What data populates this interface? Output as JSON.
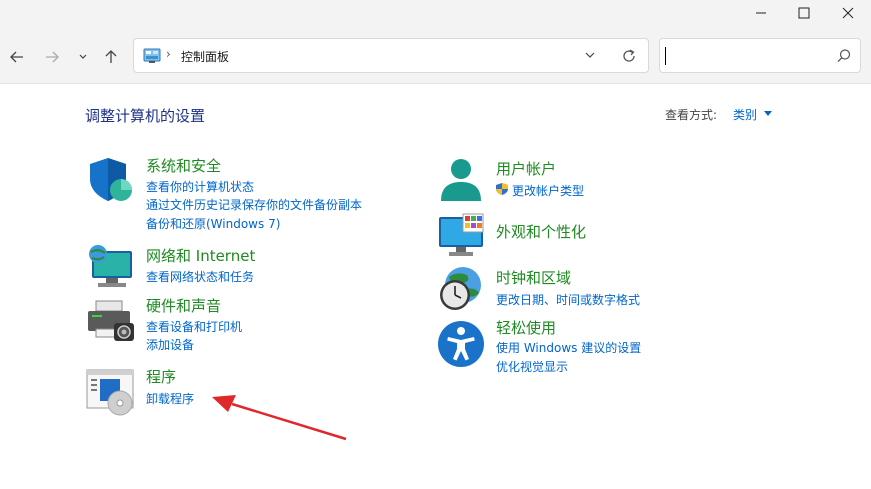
{
  "window": {
    "minimize_icon": "minimize-icon",
    "maximize_icon": "maximize-icon",
    "close_icon": "close-icon"
  },
  "nav": {
    "back_icon": "arrow-left-icon",
    "forward_icon": "arrow-right-icon",
    "recent_icon": "chevron-down-icon",
    "up_icon": "arrow-up-icon"
  },
  "address": {
    "separator": "›",
    "text": "控制面板"
  },
  "search": {
    "placeholder": ""
  },
  "header": {
    "title": "调整计算机的设置",
    "view_label": "查看方式:",
    "view_value": "类别"
  },
  "categories": [
    {
      "title": "系统和安全",
      "links": [
        "查看你的计算机状态",
        "通过文件历史记录保存你的文件备份副本",
        "备份和还原(Windows 7)"
      ],
      "icon": "shield-icon"
    },
    {
      "title": "网络和 Internet",
      "links": [
        "查看网络状态和任务"
      ],
      "icon": "network-globe-icon"
    },
    {
      "title": "硬件和声音",
      "links": [
        "查看设备和打印机",
        "添加设备"
      ],
      "icon": "printer-icon"
    },
    {
      "title": "程序",
      "links": [
        "卸载程序"
      ],
      "icon": "programs-icon"
    },
    {
      "title": "用户帐户",
      "links": [
        "更改帐户类型"
      ],
      "icon": "user-icon"
    },
    {
      "title": "外观和个性化",
      "links": [],
      "icon": "monitor-palette-icon"
    },
    {
      "title": "时钟和区域",
      "links": [
        "更改日期、时间或数字格式"
      ],
      "icon": "clock-globe-icon"
    },
    {
      "title": "轻松使用",
      "links": [
        "使用 Windows 建议的设置",
        "优化视觉显示"
      ],
      "icon": "accessibility-icon"
    }
  ],
  "annotation": {
    "color": "#e0282a",
    "icon": "red-arrow-annotation"
  }
}
